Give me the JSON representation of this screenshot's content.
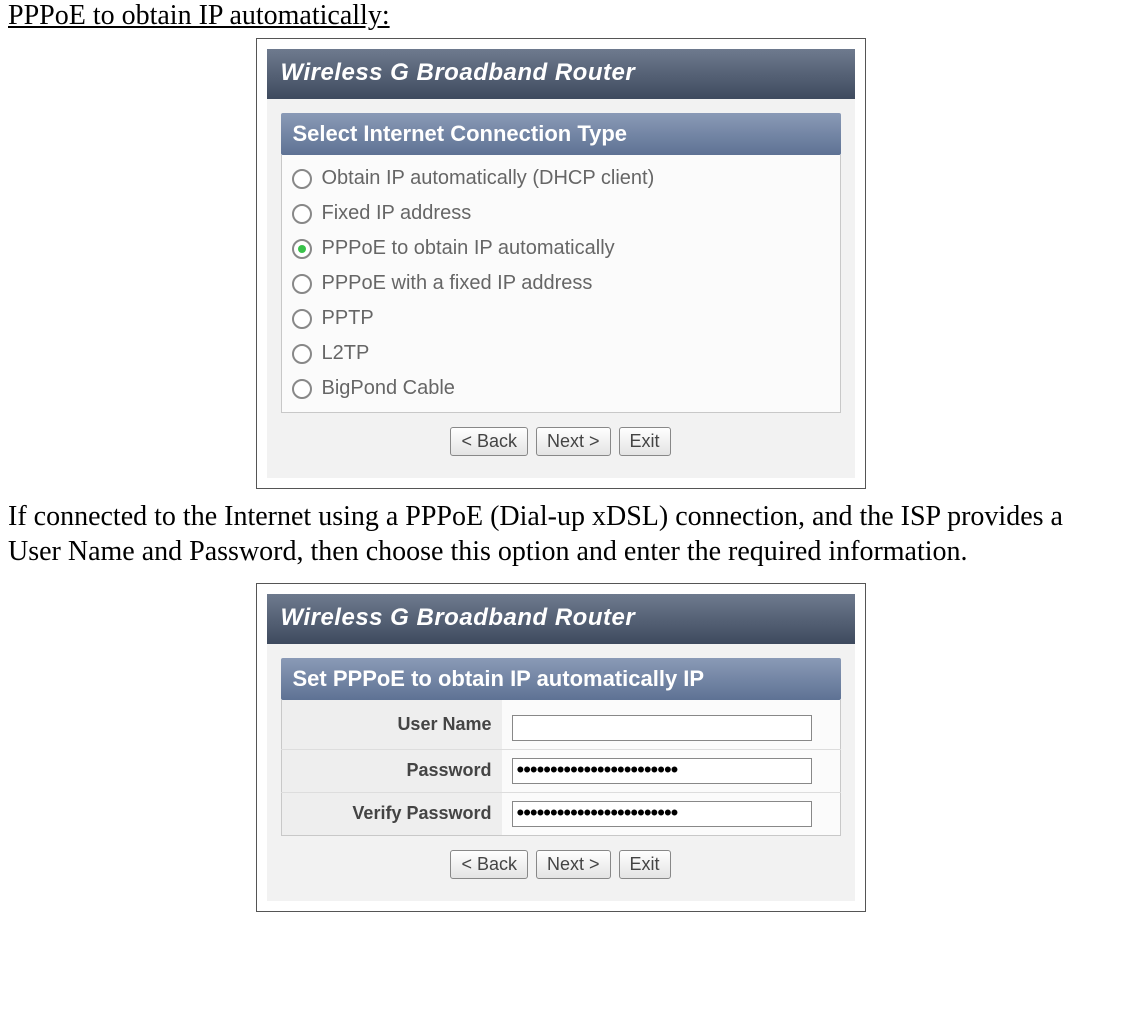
{
  "heading": "PPPoE to obtain IP automatically:",
  "paragraph": "If connected to the Internet using a PPPoE (Dial-up xDSL) connection, and the ISP provides a User Name and Password, then choose this option and enter the required information.",
  "dialog1": {
    "title": "Wireless G Broadband Router",
    "section": "Select Internet Connection Type",
    "options": [
      {
        "label": "Obtain IP automatically (DHCP client)",
        "selected": false
      },
      {
        "label": "Fixed IP address",
        "selected": false
      },
      {
        "label": "PPPoE to obtain IP automatically",
        "selected": true
      },
      {
        "label": "PPPoE with a fixed IP address",
        "selected": false
      },
      {
        "label": "PPTP",
        "selected": false
      },
      {
        "label": "L2TP",
        "selected": false
      },
      {
        "label": "BigPond Cable",
        "selected": false
      }
    ],
    "buttons": {
      "back": "< Back",
      "next": "Next >",
      "exit": "Exit"
    }
  },
  "dialog2": {
    "title": "Wireless G Broadband Router",
    "section": "Set PPPoE to obtain IP automatically IP",
    "fields": {
      "username_label": "User Name",
      "username_value": "",
      "password_label": "Password",
      "password_value": "••••••••••••••••••••••••",
      "verify_label": "Verify Password",
      "verify_value": "••••••••••••••••••••••••"
    },
    "buttons": {
      "back": "< Back",
      "next": "Next >",
      "exit": "Exit"
    }
  }
}
